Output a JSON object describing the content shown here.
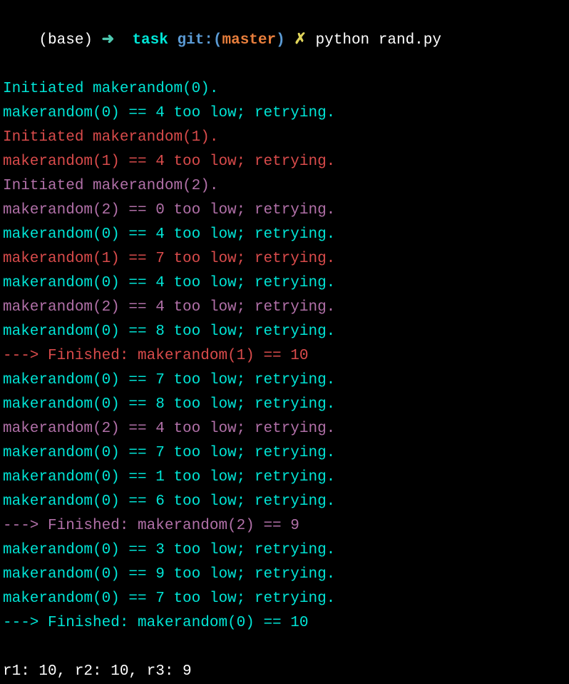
{
  "prompt": {
    "base": "(base) ",
    "arrow": "➜  ",
    "task": "task ",
    "git": "git:",
    "paren_open": "(",
    "branch": "master",
    "paren_close": ") ",
    "x": "✗ ",
    "cmd": "python rand.py"
  },
  "lines": [
    {
      "text": "Initiated makerandom(0).",
      "color": "c-cyan"
    },
    {
      "text": "makerandom(0) == 4 too low; retrying.",
      "color": "c-cyan"
    },
    {
      "text": "Initiated makerandom(1).",
      "color": "c-red"
    },
    {
      "text": "makerandom(1) == 4 too low; retrying.",
      "color": "c-red"
    },
    {
      "text": "Initiated makerandom(2).",
      "color": "c-magenta"
    },
    {
      "text": "makerandom(2) == 0 too low; retrying.",
      "color": "c-magenta"
    },
    {
      "text": "makerandom(0) == 4 too low; retrying.",
      "color": "c-cyan"
    },
    {
      "text": "makerandom(1) == 7 too low; retrying.",
      "color": "c-red"
    },
    {
      "text": "makerandom(0) == 4 too low; retrying.",
      "color": "c-cyan"
    },
    {
      "text": "makerandom(2) == 4 too low; retrying.",
      "color": "c-magenta"
    },
    {
      "text": "makerandom(0) == 8 too low; retrying.",
      "color": "c-cyan"
    },
    {
      "text": "---> Finished: makerandom(1) == 10",
      "color": "c-red"
    },
    {
      "text": "makerandom(0) == 7 too low; retrying.",
      "color": "c-cyan"
    },
    {
      "text": "makerandom(0) == 8 too low; retrying.",
      "color": "c-cyan"
    },
    {
      "text": "makerandom(2) == 4 too low; retrying.",
      "color": "c-magenta"
    },
    {
      "text": "makerandom(0) == 7 too low; retrying.",
      "color": "c-cyan"
    },
    {
      "text": "makerandom(0) == 1 too low; retrying.",
      "color": "c-cyan"
    },
    {
      "text": "makerandom(0) == 6 too low; retrying.",
      "color": "c-cyan"
    },
    {
      "text": "---> Finished: makerandom(2) == 9",
      "color": "c-magenta"
    },
    {
      "text": "makerandom(0) == 3 too low; retrying.",
      "color": "c-cyan"
    },
    {
      "text": "makerandom(0) == 9 too low; retrying.",
      "color": "c-cyan"
    },
    {
      "text": "makerandom(0) == 7 too low; retrying.",
      "color": "c-cyan"
    },
    {
      "text": "---> Finished: makerandom(0) == 10",
      "color": "c-cyan"
    },
    {
      "text": "",
      "color": "c-white"
    },
    {
      "text": "r1: 10, r2: 10, r3: 9",
      "color": "c-white"
    }
  ]
}
